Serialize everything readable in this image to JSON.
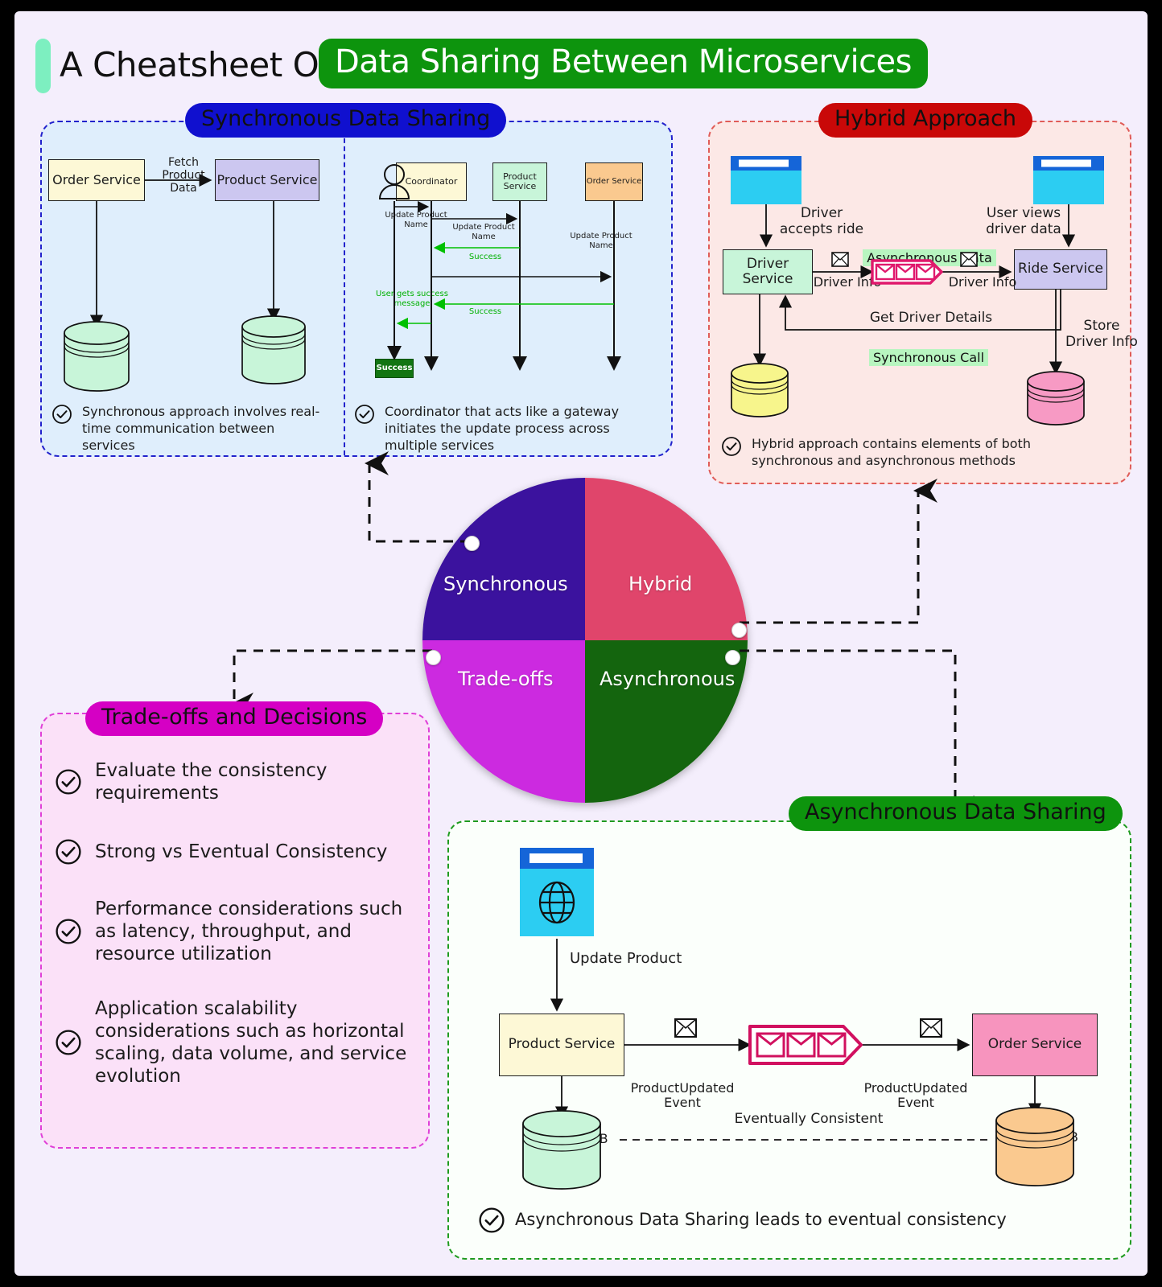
{
  "header": {
    "plain_title": "A Cheatsheet On",
    "highlight_title": "Data Sharing Between Microservices",
    "accent_color": "#7defc0",
    "highlight_bg": "#0d940d"
  },
  "panels": {
    "sync": {
      "title": "Synchronous Data Sharing",
      "title_bg": "#1010cf",
      "bg": "#dfeefc",
      "border": "#2222cc",
      "left_diagram": {
        "order_service": "Order Service",
        "product_service": "Product Service",
        "edge_label": "Fetch\nProduct\nData",
        "order_db": "Order DB",
        "product_db": "Product\nDB"
      },
      "note_left": "Synchronous approach involves real-time communication between services",
      "sequence": {
        "actor": "user-icon",
        "participants": [
          "Coordinator",
          "Product\nService",
          "Order Service"
        ],
        "messages": [
          "Update Product\nName",
          "Update Product\nName",
          "Success",
          "Update Product\nName",
          "Success",
          "User gets success\nmessage"
        ],
        "terminal_badge": "Success"
      },
      "note_right": "Coordinator that acts like a gateway initiates the update process across multiple services"
    },
    "hybrid": {
      "title": "Hybrid Approach",
      "title_bg": "#c90808",
      "bg": "#fce8e6",
      "border": "#e05c58",
      "labels": {
        "driver_accepts": "Driver\naccepts ride",
        "user_views": "User views\ndriver data",
        "async_tag": "Asynchronous Data",
        "sync_tag": "Synchronous Call",
        "driver_info_left": "Driver Info",
        "driver_info_right": "Driver Info",
        "get_driver_details": "Get Driver Details",
        "store_driver_info": "Store\nDriver Info"
      },
      "nodes": {
        "driver_service": "Driver\nService",
        "ride_service": "Ride Service",
        "driver_db": "Driver\nDB",
        "ride_db": "Ride DB"
      },
      "note": "Hybrid approach contains elements of both synchronous and asynchronous methods"
    },
    "tradeoffs": {
      "title": "Trade-offs and Decisions",
      "title_bg": "#d500c4",
      "bg": "#fbe1f8",
      "border": "#e040d8",
      "items": [
        "Evaluate the consistency requirements",
        "Strong vs Eventual Consistency",
        "Performance considerations such as latency, throughput, and resource utilization",
        "Application scalability considerations such as horizontal scaling, data volume, and service evolution"
      ]
    },
    "async": {
      "title": "Asynchronous Data Sharing",
      "title_bg": "#0d940d",
      "bg": "#fbfffb",
      "border": "#1f9b1f",
      "labels": {
        "update_product": "Update Product",
        "event_left": "ProductUpdated\nEvent",
        "event_right": "ProductUpdated\nEvent",
        "eventually_consistent": "Eventually Consistent"
      },
      "nodes": {
        "product_service": "Product Service",
        "order_service": "Order Service",
        "product_db": "Product DB",
        "order_db": "Order DB"
      },
      "note": "Asynchronous Data Sharing leads to eventual consistency"
    }
  },
  "chart_data": {
    "type": "pie",
    "title": "",
    "categories": [
      "Synchronous",
      "Hybrid",
      "Trade-offs",
      "Asynchronous"
    ],
    "values": [
      25,
      25,
      25,
      25
    ],
    "colors": [
      "#3b129e",
      "#e0456b",
      "#cc2ae0",
      "#14650e"
    ],
    "legend": "none",
    "labels_inside": true
  }
}
